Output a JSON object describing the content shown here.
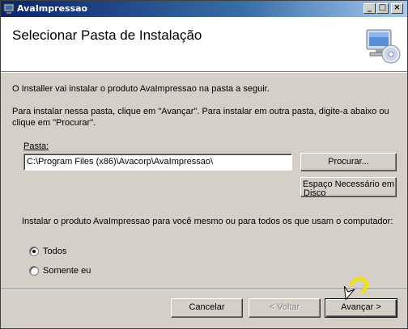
{
  "window": {
    "title": "AvaImpressao",
    "minimize_glyph": "_",
    "maximize_glyph": "□",
    "close_glyph": "×"
  },
  "header": {
    "title": "Selecionar Pasta de Instalação",
    "icon": "computer-cd-icon"
  },
  "body": {
    "intro": "O Installer vai instalar o produto AvaImpressao na pasta a seguir.",
    "instructions_line1": "Para instalar nessa pasta, clique em \"Avançar\". Para instalar em outra pasta, digite-a abaixo ou",
    "instructions_line2": "clique em \"Procurar\".",
    "folder_label": "Pasta:",
    "folder_value": "C:\\Program Files (x86)\\Avacorp\\AvaImpressao\\",
    "browse_label": "Procurar...",
    "disk_cost_label_line1": "Espaço Necessário em",
    "disk_cost_label_line2": "Disco",
    "install_for_question": "Instalar o produto AvaImpressao para você mesmo ou para todos os que usam o computador:",
    "options": [
      {
        "label": "Todos",
        "selected": true
      },
      {
        "label": "Somente eu",
        "selected": false
      }
    ]
  },
  "footer": {
    "cancel_label": "Cancelar",
    "back_label": "< Voltar",
    "next_label": "Avançar >"
  },
  "colors": {
    "titlebar_start": "#0a246a",
    "titlebar_end": "#a6caf0",
    "face": "#d4d0c8",
    "cursor_highlight": "#f5e000"
  }
}
